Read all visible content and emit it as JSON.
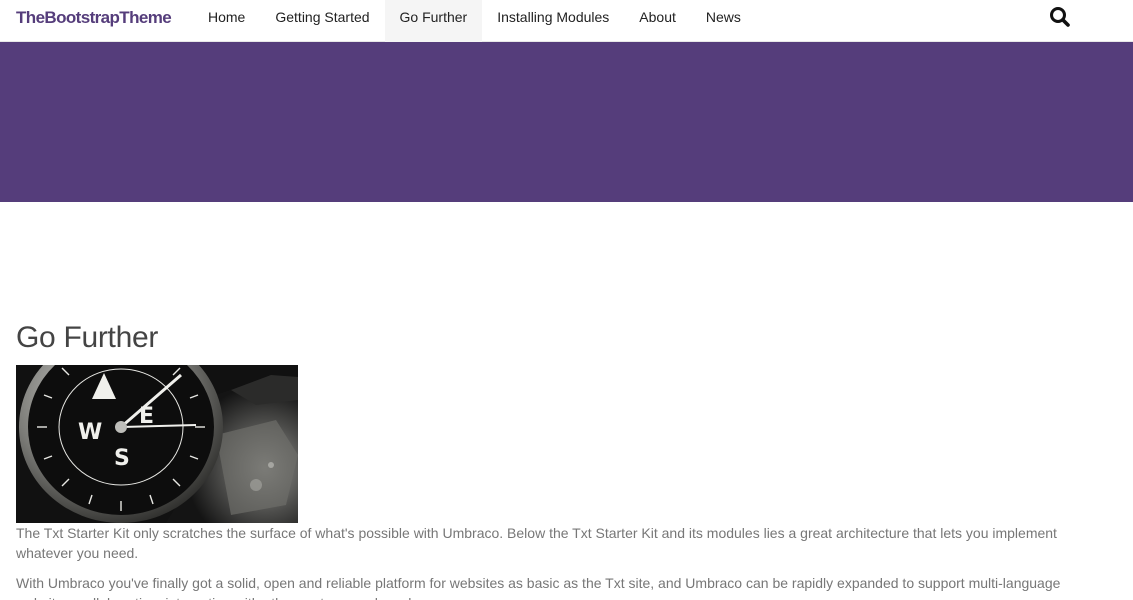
{
  "header": {
    "brand": "TheBootstrapTheme",
    "nav": [
      {
        "label": "Home",
        "active": false
      },
      {
        "label": "Getting Started",
        "active": false
      },
      {
        "label": "Go Further",
        "active": true
      },
      {
        "label": "Installing Modules",
        "active": false
      },
      {
        "label": "About",
        "active": false
      },
      {
        "label": "News",
        "active": false
      }
    ],
    "search_icon": "search-icon"
  },
  "banner": {
    "color": "#553d7b"
  },
  "main": {
    "title": "Go Further",
    "image": "compass-photo",
    "paragraphs": [
      "The Txt Starter Kit only scratches the surface of what's possible with Umbraco. Below the Txt Starter Kit and its modules lies a great architecture that lets you implement whatever you need.",
      "With Umbraco you've finally got a solid, open and reliable platform for websites as basic as the Txt site, and Umbraco can be rapidly expanded to support multi-language websites, collaboration, integration with other systems and much more."
    ]
  },
  "colors": {
    "brand": "#553d7b",
    "nav_active_bg": "#f5f5f5",
    "body_text": "#777777",
    "heading_text": "#444444"
  }
}
